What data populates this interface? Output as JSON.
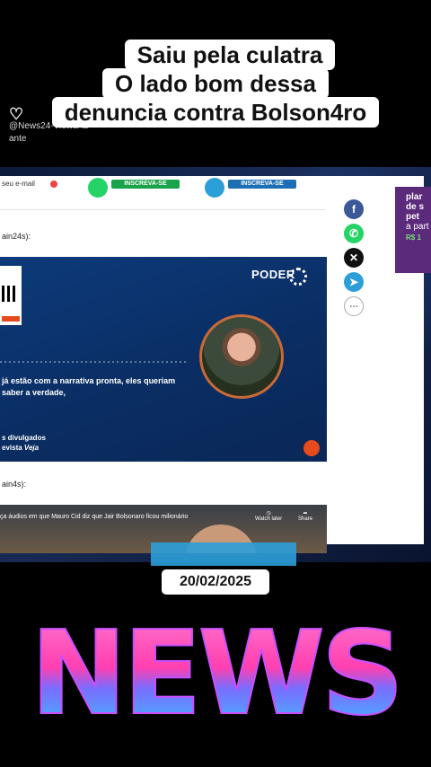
{
  "caption": {
    "line1": "Saiu pela culatra",
    "line2": "O lado bom dessa",
    "line3": "denuncia contra Bolson4ro"
  },
  "overlay": {
    "logo": "♡",
    "handle": "@News24-ViewsAu",
    "sub": "ante"
  },
  "page": {
    "email_label": "seu e-mail",
    "subscribe_whatsapp": "INSCREVA-SE",
    "subscribe_telegram": "INSCREVA-SE",
    "source_one": "ain24s):",
    "source_two": "ain4s):",
    "video": {
      "brand": "PODER",
      "quote": "já estão com a narrativa pronta, eles queriam saber a verdade,",
      "divulg_line1": "s divulgados",
      "divulg_line2": "evista",
      "divulg_italic": "Veja"
    },
    "yt": {
      "title": "ça áudios em que Mauro Cid diz que Jair Bolsonaro ficou milionário",
      "watch": "Watch later",
      "share": "Share"
    },
    "social": [
      "f",
      "✆",
      "✕",
      "➤",
      "⋯"
    ],
    "ad": {
      "line1": "plar",
      "line2": "de s",
      "line3": "pet",
      "line4": "a part",
      "price": "R$ 1"
    }
  },
  "date": "20/02/2025",
  "banner": "NEWS"
}
